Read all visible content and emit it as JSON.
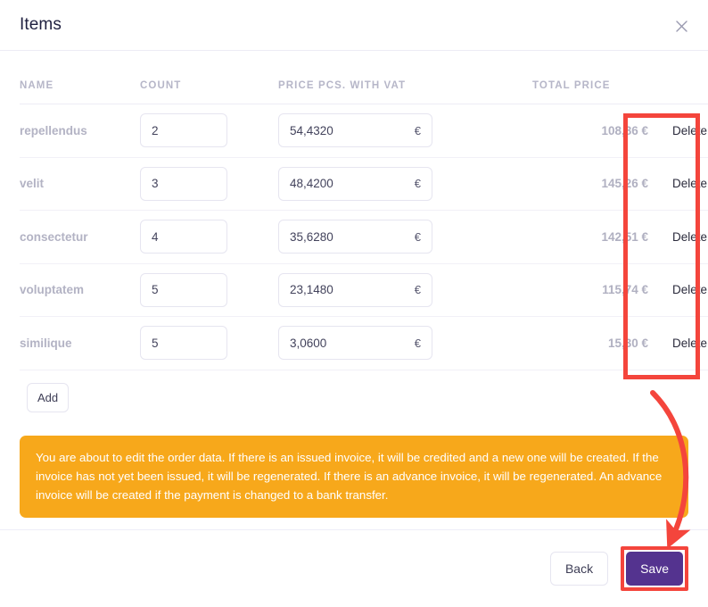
{
  "header": {
    "title": "Items",
    "close_icon": "close-icon"
  },
  "table": {
    "columns": [
      "NAME",
      "COUNT",
      "PRICE PCS. WITH VAT",
      "TOTAL PRICE",
      ""
    ],
    "currency_symbol": "€",
    "rows": [
      {
        "name": "repellendus",
        "count": "2",
        "price": "54,4320",
        "total": "108,86 €",
        "action": "Delete"
      },
      {
        "name": "velit",
        "count": "3",
        "price": "48,4200",
        "total": "145,26 €",
        "action": "Delete"
      },
      {
        "name": "consectetur",
        "count": "4",
        "price": "35,6280",
        "total": "142,51 €",
        "action": "Delete"
      },
      {
        "name": "voluptatem",
        "count": "5",
        "price": "23,1480",
        "total": "115,74 €",
        "action": "Delete"
      },
      {
        "name": "similique",
        "count": "5",
        "price": "3,0600",
        "total": "15,30 €",
        "action": "Delete"
      }
    ],
    "add_label": "Add"
  },
  "warning": {
    "text": "You are about to edit the order data. If there is an issued invoice, it will be credited and a new one will be created. If the invoice has not yet been issued, it will be regenerated. If there is an advance invoice, it will be regenerated. An advance invoice will be created if the payment is changed to a bank transfer.",
    "color": "#f7a81b"
  },
  "footer": {
    "back_label": "Back",
    "save_label": "Save",
    "save_color": "#54338f"
  },
  "annotations": {
    "highlight_color": "#f4453c",
    "delete_column_box": "highlight-box-delete-column",
    "arrow": "curved-arrow-to-save"
  }
}
